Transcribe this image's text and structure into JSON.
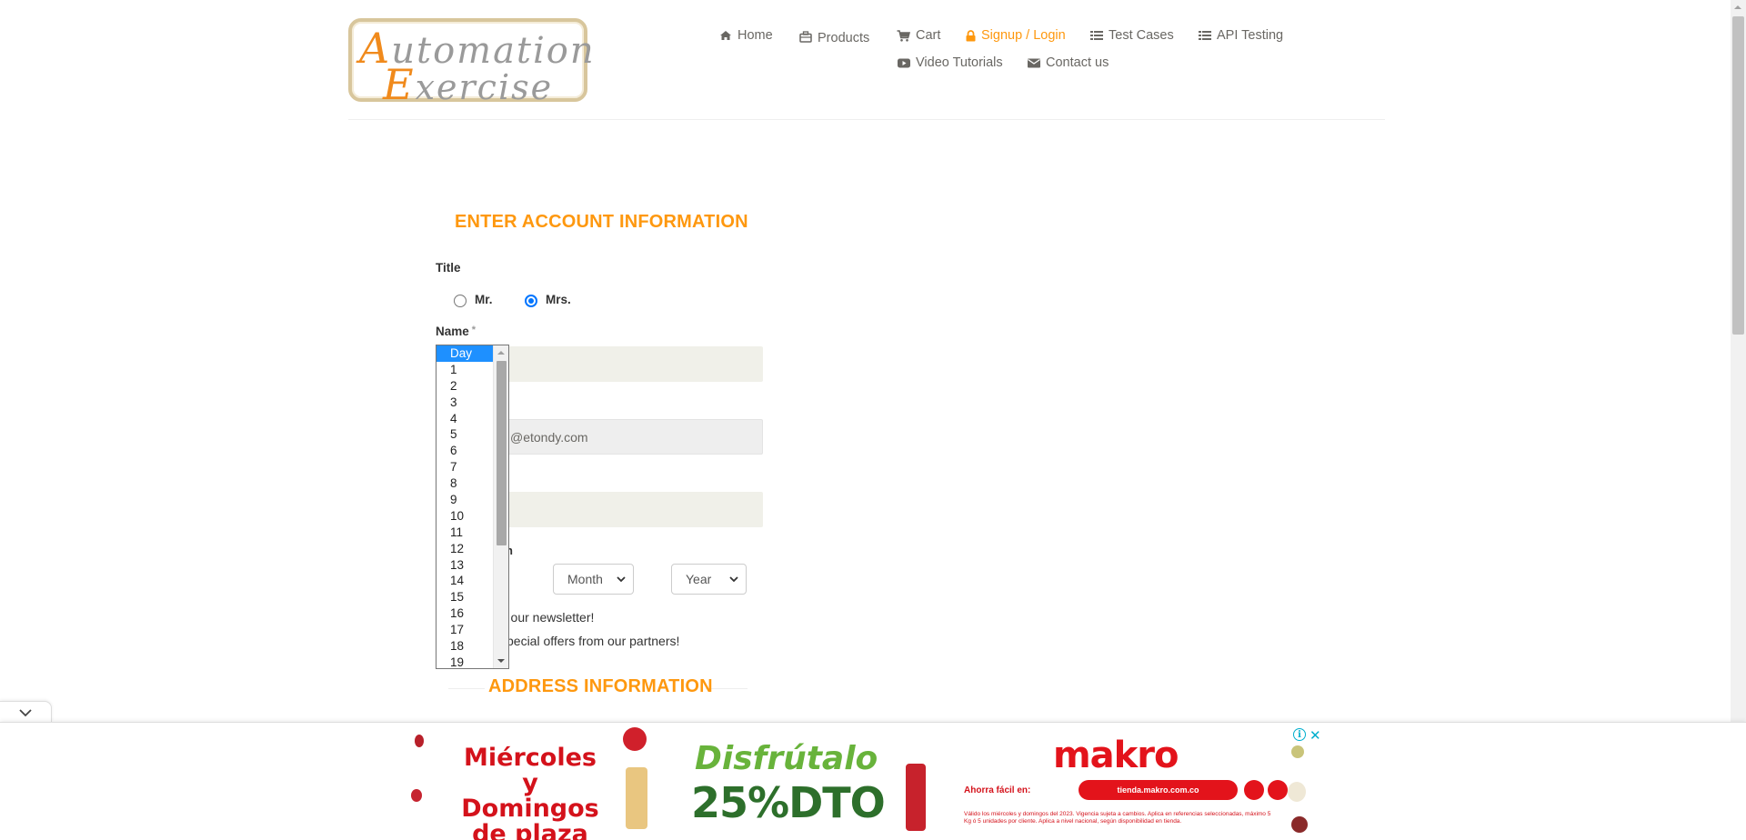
{
  "header": {
    "logo": {
      "line1": "Automation",
      "line2": "Exercise"
    },
    "nav": [
      {
        "label": "Home",
        "icon": "home-icon"
      },
      {
        "label": "Products",
        "icon": "briefcase-icon"
      },
      {
        "label": "Cart",
        "icon": "cart-icon"
      },
      {
        "label": "Signup / Login",
        "icon": "lock-icon",
        "active": true
      },
      {
        "label": "Test Cases",
        "icon": "list-icon"
      },
      {
        "label": "API Testing",
        "icon": "list-icon"
      },
      {
        "label": "Video Tutorials",
        "icon": "youtube-icon"
      },
      {
        "label": "Contact us",
        "icon": "envelope-icon"
      }
    ],
    "active_color": "#fe980f"
  },
  "form": {
    "heading": "ENTER ACCOUNT INFORMATION",
    "title_label": "Title",
    "title_options": [
      {
        "label": "Mr.",
        "checked": false
      },
      {
        "label": "Mrs.",
        "checked": true
      }
    ],
    "name_label": "Name",
    "name_required": "*",
    "email_partial_value": "@etondy.com",
    "dob_selects": {
      "month": "Month",
      "year": "Year"
    },
    "newsletter_partial": "r our newsletter!",
    "offers_partial": "pecial offers from our partners!",
    "dob_partial_label": "h"
  },
  "day_dropdown": {
    "options": [
      "Day",
      "1",
      "2",
      "3",
      "4",
      "5",
      "6",
      "7",
      "8",
      "9",
      "10",
      "11",
      "12",
      "13",
      "14",
      "15",
      "16",
      "17",
      "18",
      "19"
    ],
    "selected": "Day"
  },
  "address": {
    "heading": "ADDRESS INFORMATION"
  },
  "ad": {
    "headline1": "Miércoles y Domingos de plaza",
    "headline2": "Disfrútalo",
    "discount": "25%DTO",
    "brand": "makro",
    "easy_buy": "Ahorra fácil en:",
    "url": "tienda.makro.com.co",
    "fine_print": "Válido los miércoles y domingos del 2023. Vigencia sujeta a cambios. Aplica en referencias seleccionadas, máximo 5 Kg ó 5 unidades por cliente. Aplica a nivel nacional, según disponibilidad en tienda.",
    "info_label": "i",
    "close_label": "✕"
  }
}
